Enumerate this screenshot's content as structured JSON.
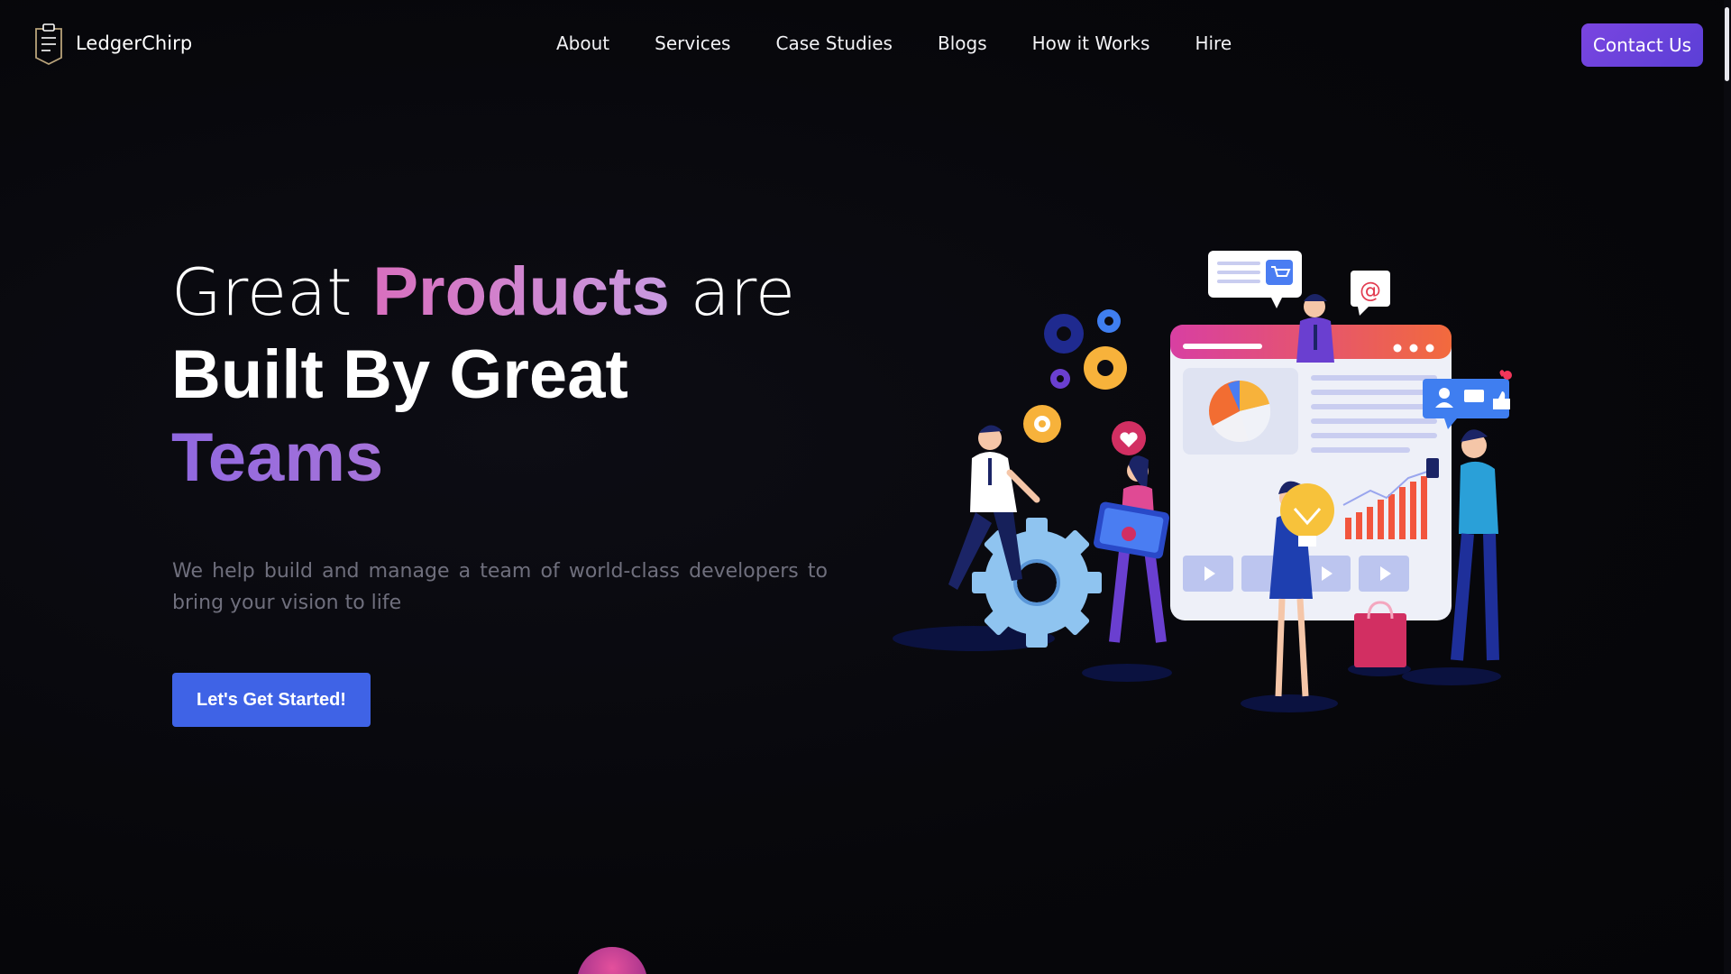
{
  "brand": {
    "name": "LedgerChirp",
    "logo_icon": "clipboard-badge-icon"
  },
  "nav": {
    "items": [
      {
        "label": "About"
      },
      {
        "label": "Services"
      },
      {
        "label": "Case Studies"
      },
      {
        "label": "Blogs"
      },
      {
        "label": "How it Works"
      },
      {
        "label": "Hire"
      }
    ],
    "contact_label": "Contact Us"
  },
  "hero": {
    "line1_pre": "Great ",
    "line1_highlight": "Products",
    "line1_post": " are",
    "line2": "Built By Great",
    "line3": "Teams",
    "subtitle": "We help build and manage a team of world-class developers to bring your vision to life",
    "cta_label": "Let's Get Started!"
  },
  "colors": {
    "background": "#07070b",
    "accent_purple": "#6a42dc",
    "cta_blue": "#3f63e6",
    "highlight_pink": "#d86fbe",
    "subtitle_gray": "#6f6f7d"
  }
}
